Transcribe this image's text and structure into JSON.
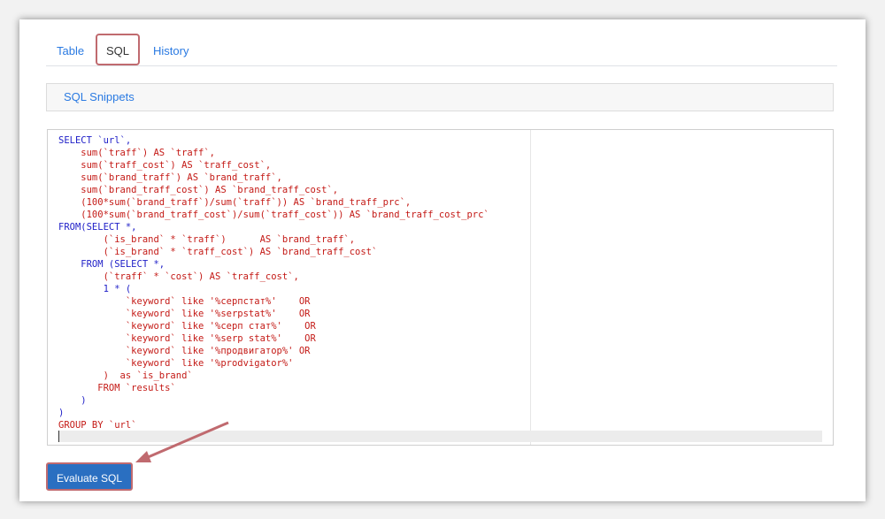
{
  "tabs": [
    {
      "label": "Table",
      "active": false
    },
    {
      "label": "SQL",
      "active": true
    },
    {
      "label": "History",
      "active": false
    }
  ],
  "snippets_label": "SQL Snippets",
  "code_lines": [
    {
      "text": "SELECT `url`,",
      "style": "kw"
    },
    {
      "text": "    sum(`traff`) AS `traff`,",
      "style": "str"
    },
    {
      "text": "    sum(`traff_cost`) AS `traff_cost`,",
      "style": "str"
    },
    {
      "text": "    sum(`brand_traff`) AS `brand_traff`,",
      "style": "str"
    },
    {
      "text": "    sum(`brand_traff_cost`) AS `brand_traff_cost`,",
      "style": "str"
    },
    {
      "text": "    (100*sum(`brand_traff`)/sum(`traff`)) AS `brand_traff_prc`,",
      "style": "str"
    },
    {
      "text": "    (100*sum(`brand_traff_cost`)/sum(`traff_cost`)) AS `brand_traff_cost_prc`",
      "style": "str"
    },
    {
      "text": "FROM(SELECT *,",
      "style": "kw"
    },
    {
      "text": "        (`is_brand` * `traff`)      AS `brand_traff`,",
      "style": "str"
    },
    {
      "text": "        (`is_brand` * `traff_cost`) AS `brand_traff_cost`",
      "style": "str"
    },
    {
      "text": "    FROM (SELECT *,",
      "style": "kw"
    },
    {
      "text": "        (`traff` * `cost`) AS `traff_cost`,",
      "style": "str"
    },
    {
      "text": "        1 * (",
      "style": "kw"
    },
    {
      "text": "            `keyword` like '%серпстат%'    OR",
      "style": "str"
    },
    {
      "text": "            `keyword` like '%serpstat%'    OR",
      "style": "str"
    },
    {
      "text": "            `keyword` like '%серп стат%'    OR",
      "style": "str"
    },
    {
      "text": "            `keyword` like '%serp stat%'    OR",
      "style": "str"
    },
    {
      "text": "            `keyword` like '%продвигатор%' OR",
      "style": "str"
    },
    {
      "text": "            `keyword` like '%prodvigator%'",
      "style": "str"
    },
    {
      "text": "        )  as `is_brand`",
      "style": "str"
    },
    {
      "text": "       FROM `results`",
      "style": "str"
    },
    {
      "text": "    )",
      "style": "kw"
    },
    {
      "text": ")",
      "style": "kw"
    },
    {
      "text": "GROUP BY `url`",
      "style": "str"
    }
  ],
  "evaluate_label": "Evaluate SQL",
  "colors": {
    "accent": "#2a6fc1",
    "link": "#2a7ae2",
    "highlight": "#c06a6f"
  }
}
